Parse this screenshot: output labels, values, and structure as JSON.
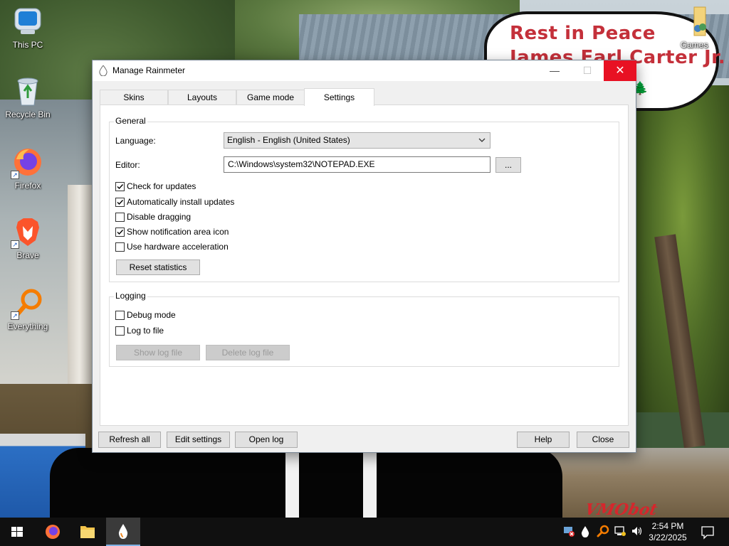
{
  "wallpaper": {
    "bubble_line1": "Rest in Peace",
    "bubble_line2": "James Earl Carter Jr.",
    "watermark": "VMObot"
  },
  "desktop": {
    "icons": [
      {
        "label": "This PC",
        "icon": "computer-icon"
      },
      {
        "label": "Recycle Bin",
        "icon": "recycle-bin-icon"
      },
      {
        "label": "Firefox",
        "icon": "firefox-icon"
      },
      {
        "label": "Brave",
        "icon": "brave-icon"
      },
      {
        "label": "Everything",
        "icon": "everything-search-icon"
      },
      {
        "label": "Games",
        "icon": "games-folder-icon"
      }
    ]
  },
  "window": {
    "title": "Manage Rainmeter",
    "controls": {
      "minimize": "—",
      "maximize": "☐",
      "close": "✕"
    },
    "tabs": [
      {
        "label": "Skins"
      },
      {
        "label": "Layouts"
      },
      {
        "label": "Game mode"
      },
      {
        "label": "Settings",
        "active": true
      }
    ],
    "general": {
      "title": "General",
      "language_label": "Language:",
      "language_value": "English - English (United States)",
      "editor_label": "Editor:",
      "editor_value": "C:\\Windows\\system32\\NOTEPAD.EXE",
      "browse_label": "...",
      "checkboxes": [
        {
          "label": "Check for updates",
          "checked": true
        },
        {
          "label": "Automatically install updates",
          "checked": true
        },
        {
          "label": "Disable dragging",
          "checked": false
        },
        {
          "label": "Show notification area icon",
          "checked": true
        },
        {
          "label": "Use hardware acceleration",
          "checked": false
        }
      ],
      "reset_label": "Reset statistics"
    },
    "logging": {
      "title": "Logging",
      "checkboxes": [
        {
          "label": "Debug mode",
          "checked": false
        },
        {
          "label": "Log to file",
          "checked": false
        }
      ],
      "show_log_label": "Show log file",
      "delete_log_label": "Delete log file"
    },
    "footer": {
      "refresh_all": "Refresh all",
      "edit_settings": "Edit settings",
      "open_log": "Open log",
      "help": "Help",
      "close": "Close"
    }
  },
  "taskbar": {
    "items": [
      "start-button",
      "firefox",
      "file-explorer",
      "rainmeter"
    ],
    "tray_icons": [
      "network-warning-icon",
      "rainmeter-tray-icon",
      "everything-tray-icon",
      "network-icon",
      "volume-icon"
    ],
    "clock_time": "2:54 PM",
    "clock_date": "3/22/2025"
  },
  "colors": {
    "accent": "#e81123",
    "bubble_text": "#c4303a",
    "taskbar": "#101010"
  }
}
